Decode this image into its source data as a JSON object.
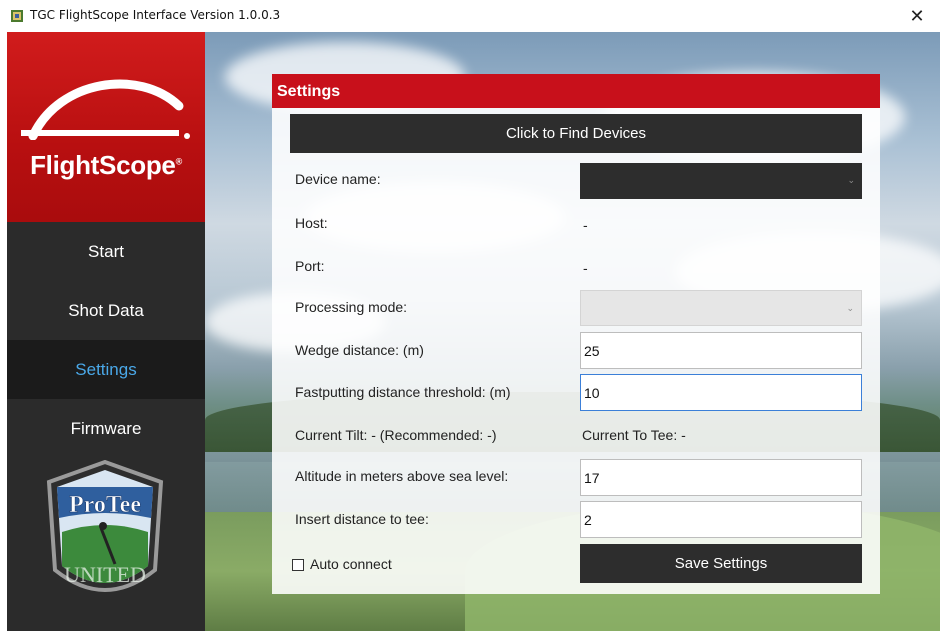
{
  "window": {
    "title": "TGC FlightScope Interface Version 1.0.0.3",
    "close_glyph": "✕"
  },
  "sidebar": {
    "brand_name": "FlightScope",
    "brand_mark": "®",
    "items": [
      {
        "label": "Start"
      },
      {
        "label": "Shot Data"
      },
      {
        "label": "Settings"
      },
      {
        "label": "Firmware"
      }
    ],
    "active_item": "Settings",
    "active_color": "#4aa8e8",
    "badge_text": "ProTee",
    "badge_subtext": "UNITED"
  },
  "settings": {
    "title": "Settings",
    "find_devices_label": "Click to Find Devices",
    "device_name_label": "Device name:",
    "device_name_value": "",
    "host_label": "Host:",
    "host_value": "-",
    "port_label": "Port:",
    "port_value": "-",
    "processing_mode_label": "Processing mode:",
    "processing_mode_value": "",
    "wedge_label": "Wedge distance: (m)",
    "wedge_value": "25",
    "fastputting_label": "Fastputting distance threshold: (m)",
    "fastputting_value": "10",
    "tilt_text": "Current Tilt: - (Recommended: -)",
    "to_tee_text": "Current To Tee: -",
    "altitude_label": "Altitude in meters above sea level:",
    "altitude_value": "17",
    "tee_distance_label": "Insert distance to tee:",
    "tee_distance_value": "2",
    "auto_connect_label": "Auto connect",
    "auto_connect_checked": false,
    "save_label": "Save Settings",
    "header_color": "#c8101b"
  }
}
